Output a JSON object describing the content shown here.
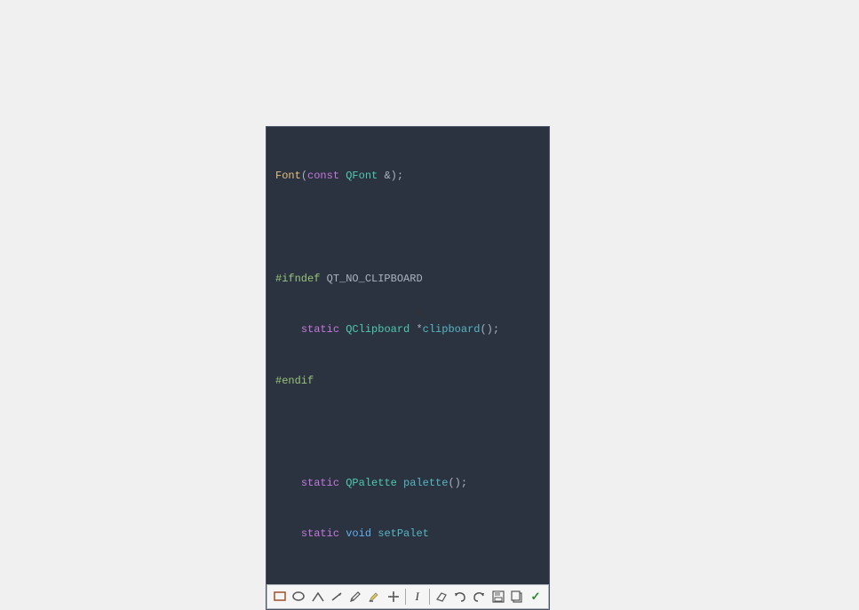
{
  "background_color": "#f0f0f0",
  "code_widget": {
    "lines": [
      {
        "text": "Font(const QFont &);",
        "tokens": [
          {
            "text": "Font",
            "class": "kw-yellow"
          },
          {
            "text": "(",
            "class": "kw-white"
          },
          {
            "text": "const",
            "class": "kw-purple"
          },
          {
            "text": " ",
            "class": "kw-white"
          },
          {
            "text": "QFont",
            "class": "kw-teal"
          },
          {
            "text": " &);",
            "class": "kw-white"
          }
        ]
      },
      {
        "text": "",
        "tokens": []
      },
      {
        "text": "#ifndef QT_NO_CLIPBOARD",
        "tokens": [
          {
            "text": "#ifndef",
            "class": "kw-green"
          },
          {
            "text": " ",
            "class": "kw-white"
          },
          {
            "text": "QT_NO_CLIPBOARD",
            "class": "kw-white"
          }
        ]
      },
      {
        "text": "    static QClipboard *clipboard();",
        "tokens": [
          {
            "text": "    ",
            "class": "kw-white"
          },
          {
            "text": "static",
            "class": "kw-purple"
          },
          {
            "text": " ",
            "class": "kw-white"
          },
          {
            "text": "QClipboard",
            "class": "kw-teal"
          },
          {
            "text": " *",
            "class": "kw-white"
          },
          {
            "text": "clipboard",
            "class": "kw-cyan"
          },
          {
            "text": "();",
            "class": "kw-white"
          }
        ]
      },
      {
        "text": "#endif",
        "tokens": [
          {
            "text": "#endif",
            "class": "kw-green"
          }
        ]
      },
      {
        "text": "",
        "tokens": []
      },
      {
        "text": "    static QPalette palette();",
        "tokens": [
          {
            "text": "    ",
            "class": "kw-white"
          },
          {
            "text": "static",
            "class": "kw-purple"
          },
          {
            "text": " ",
            "class": "kw-white"
          },
          {
            "text": "QPalette",
            "class": "kw-teal"
          },
          {
            "text": " ",
            "class": "kw-white"
          },
          {
            "text": "palette",
            "class": "kw-cyan"
          },
          {
            "text": "();",
            "class": "kw-white"
          }
        ]
      },
      {
        "text": "    static void setPalet",
        "tokens": [
          {
            "text": "    ",
            "class": "kw-white"
          },
          {
            "text": "static",
            "class": "kw-purple"
          },
          {
            "text": " ",
            "class": "kw-white"
          },
          {
            "text": "void",
            "class": "kw-blue"
          },
          {
            "text": " ",
            "class": "kw-white"
          },
          {
            "text": "setPalet",
            "class": "kw-cyan"
          }
        ]
      }
    ],
    "toolbar": {
      "buttons": [
        {
          "name": "rectangle-tool",
          "icon": "▭",
          "tooltip": "Rectangle"
        },
        {
          "name": "ellipse-tool",
          "icon": "○",
          "tooltip": "Ellipse"
        },
        {
          "name": "angle-tool",
          "icon": "∧",
          "tooltip": "Angle"
        },
        {
          "name": "line-tool",
          "icon": "╱",
          "tooltip": "Line"
        },
        {
          "name": "pencil-tool",
          "icon": "✏",
          "tooltip": "Pencil"
        },
        {
          "name": "highlight-tool",
          "icon": "◈",
          "tooltip": "Highlight"
        },
        {
          "name": "cross-tool",
          "icon": "✕",
          "tooltip": "Cross"
        },
        {
          "name": "text-tool",
          "icon": "I",
          "tooltip": "Text"
        },
        {
          "name": "eraser-tool",
          "icon": "◇",
          "tooltip": "Eraser"
        },
        {
          "name": "undo-tool",
          "icon": "↩",
          "tooltip": "Undo"
        },
        {
          "name": "redo-tool",
          "icon": "↪",
          "tooltip": "Redo"
        },
        {
          "name": "save-tool",
          "icon": "💾",
          "tooltip": "Save"
        },
        {
          "name": "copy-tool",
          "icon": "□",
          "tooltip": "Copy"
        },
        {
          "name": "ok-tool",
          "icon": "✓",
          "tooltip": "OK"
        }
      ]
    }
  }
}
